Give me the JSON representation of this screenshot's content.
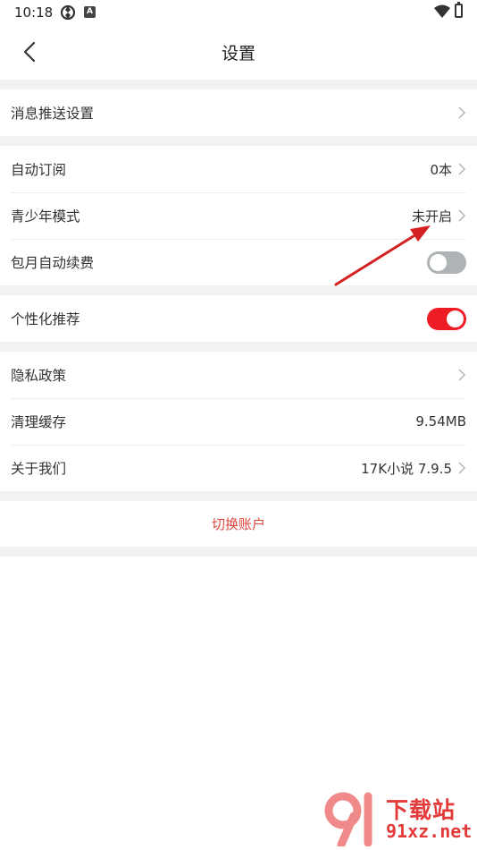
{
  "status_bar": {
    "time": "10:18",
    "icons": [
      "sync-icon",
      "a-notification-icon",
      "wifi-icon",
      "battery-icon"
    ]
  },
  "header": {
    "title": "设置",
    "back_icon": "chevron-left-icon"
  },
  "groups": [
    {
      "rows": [
        {
          "label": "消息推送设置",
          "value": "",
          "control": "chevron"
        }
      ]
    },
    {
      "rows": [
        {
          "label": "自动订阅",
          "value": "0本",
          "control": "chevron"
        },
        {
          "label": "青少年模式",
          "value": "未开启",
          "control": "chevron"
        },
        {
          "label": "包月自动续费",
          "value": "",
          "control": "toggle",
          "toggle_on": false
        }
      ]
    },
    {
      "rows": [
        {
          "label": "个性化推荐",
          "value": "",
          "control": "toggle",
          "toggle_on": true
        }
      ]
    },
    {
      "rows": [
        {
          "label": "隐私政策",
          "value": "",
          "control": "chevron"
        },
        {
          "label": "清理缓存",
          "value": "9.54MB",
          "control": "none"
        },
        {
          "label": "关于我们",
          "value": "17K小说 7.9.5",
          "control": "chevron"
        }
      ]
    }
  ],
  "switch_account": {
    "label": "切换账户"
  },
  "watermark": {
    "top": "下载站",
    "bottom": "91xz.net"
  },
  "colors": {
    "accent": "#ee1c25",
    "link_red": "#e0463c",
    "separator_bg": "#f2f2f2",
    "toggle_off": "#aeb3b5",
    "annotation_arrow": "#d42020"
  }
}
